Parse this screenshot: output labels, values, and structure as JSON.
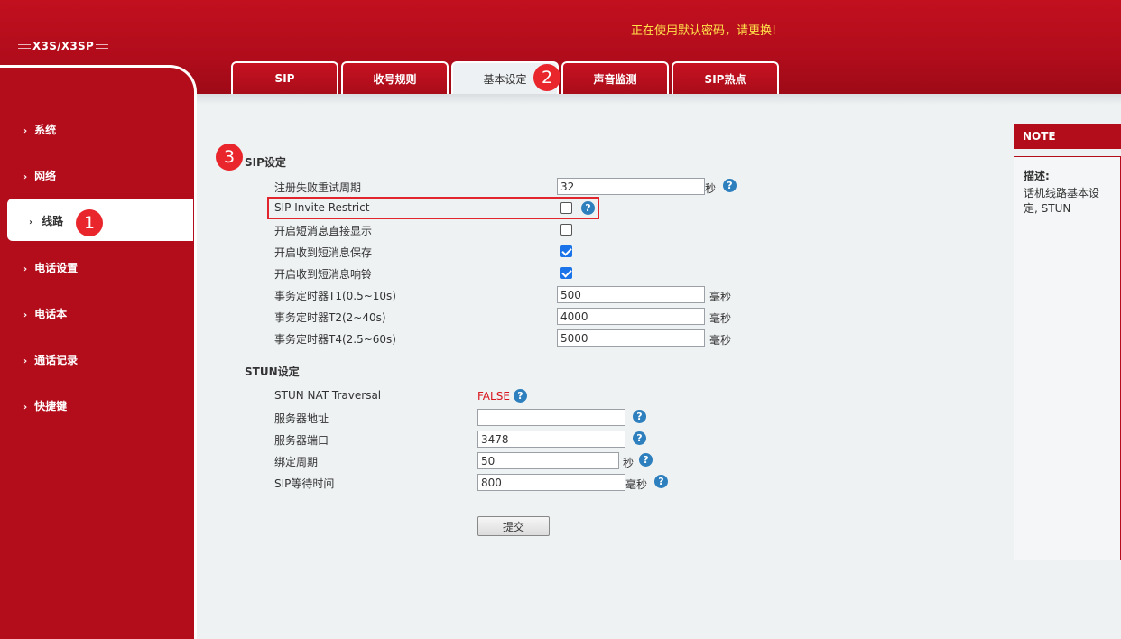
{
  "header": {
    "model": "X3S/X3SP",
    "warning": "正在使用默认密码，请更换!"
  },
  "tabs": [
    {
      "label": "SIP",
      "active": false
    },
    {
      "label": "收号规则",
      "active": false
    },
    {
      "label": "基本设定",
      "active": true
    },
    {
      "label": "声音监测",
      "active": false
    },
    {
      "label": "SIP热点",
      "active": false
    }
  ],
  "sidebar": {
    "items": [
      {
        "label": "系统"
      },
      {
        "label": "网络"
      },
      {
        "label": "线路",
        "active": true
      },
      {
        "label": "电话设置"
      },
      {
        "label": "电话本"
      },
      {
        "label": "通话记录"
      },
      {
        "label": "快捷键"
      }
    ]
  },
  "badges": [
    "1",
    "2",
    "3"
  ],
  "sip_section": {
    "title": "SIP设定",
    "register_retry_label": "注册失败重试周期",
    "register_retry_value": "32",
    "register_retry_unit": "秒",
    "invite_restrict_label": "SIP Invite Restrict",
    "invite_restrict_checked": false,
    "sms_display_label": "开启短消息直接显示",
    "sms_display_checked": false,
    "sms_save_label": "开启收到短消息保存",
    "sms_save_checked": true,
    "sms_ring_label": "开启收到短消息响铃",
    "sms_ring_checked": true,
    "t1_label": "事务定时器T1(0.5~10s)",
    "t1_value": "500",
    "t1_unit": "毫秒",
    "t2_label": "事务定时器T2(2~40s)",
    "t2_value": "4000",
    "t2_unit": "毫秒",
    "t4_label": "事务定时器T4(2.5~60s)",
    "t4_value": "5000",
    "t4_unit": "毫秒"
  },
  "stun_section": {
    "title": "STUN设定",
    "nat_label": "STUN NAT Traversal",
    "nat_value": "FALSE",
    "server_label": "服务器地址",
    "server_value": "",
    "port_label": "服务器端口",
    "port_value": "3478",
    "bind_label": "绑定周期",
    "bind_value": "50",
    "bind_unit": "秒",
    "wait_label": "SIP等待时间",
    "wait_value": "800",
    "wait_unit": "毫秒"
  },
  "submit_label": "提交",
  "note": {
    "title": "NOTE",
    "heading": "描述:",
    "text": "话机线路基本设定, STUN"
  },
  "colors": {
    "brand_red": "#b30d1c",
    "warning_yellow": "#ffe14a",
    "badge_red": "#e8262c",
    "help_blue": "#2d7fbd"
  }
}
